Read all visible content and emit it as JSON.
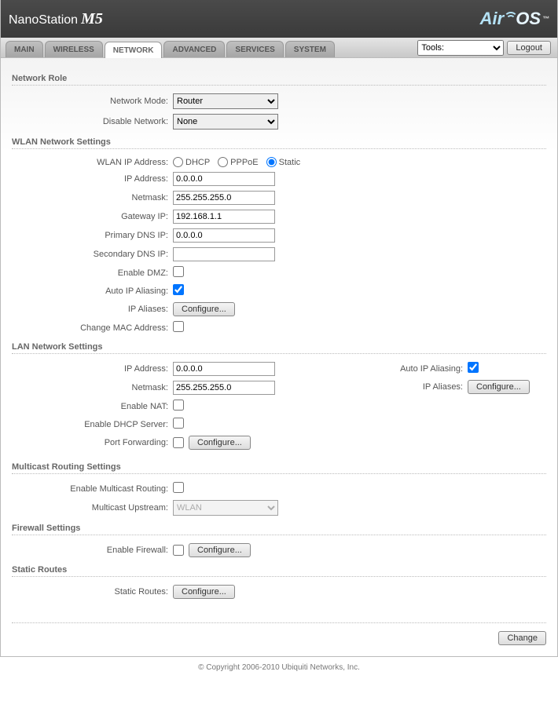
{
  "header": {
    "brand_name": "NanoStation",
    "brand_model": "M5",
    "logo_text_air": "Air",
    "logo_text_os": "OS",
    "logo_tm": "™"
  },
  "tabs": {
    "items": [
      "MAIN",
      "WIRELESS",
      "NETWORK",
      "ADVANCED",
      "SERVICES",
      "SYSTEM"
    ],
    "active_index": 2,
    "tools_label": "Tools:",
    "logout_label": "Logout"
  },
  "sections": {
    "network_role": {
      "title": "Network Role",
      "network_mode_label": "Network Mode:",
      "network_mode_value": "Router",
      "disable_network_label": "Disable Network:",
      "disable_network_value": "None"
    },
    "wlan": {
      "title": "WLAN Network Settings",
      "wlan_ip_label": "WLAN IP Address:",
      "radio_dhcp": "DHCP",
      "radio_pppoe": "PPPoE",
      "radio_static": "Static",
      "ip_address_label": "IP Address:",
      "ip_address_value": "0.0.0.0",
      "netmask_label": "Netmask:",
      "netmask_value": "255.255.255.0",
      "gateway_label": "Gateway IP:",
      "gateway_value": "192.168.1.1",
      "primary_dns_label": "Primary DNS IP:",
      "primary_dns_value": "0.0.0.0",
      "secondary_dns_label": "Secondary DNS IP:",
      "secondary_dns_value": "",
      "enable_dmz_label": "Enable DMZ:",
      "auto_ip_aliasing_label": "Auto IP Aliasing:",
      "ip_aliases_label": "IP Aliases:",
      "configure_label": "Configure...",
      "change_mac_label": "Change MAC Address:"
    },
    "lan": {
      "title": "LAN Network Settings",
      "ip_address_label": "IP Address:",
      "ip_address_value": "0.0.0.0",
      "netmask_label": "Netmask:",
      "netmask_value": "255.255.255.0",
      "enable_nat_label": "Enable NAT:",
      "enable_dhcp_server_label": "Enable DHCP Server:",
      "port_forwarding_label": "Port Forwarding:",
      "configure_label": "Configure...",
      "auto_ip_aliasing_label": "Auto IP Aliasing:",
      "ip_aliases_label": "IP Aliases:",
      "ip_aliases_configure_label": "Configure..."
    },
    "multicast": {
      "title": "Multicast Routing Settings",
      "enable_label": "Enable Multicast Routing:",
      "upstream_label": "Multicast Upstream:",
      "upstream_value": "WLAN"
    },
    "firewall": {
      "title": "Firewall Settings",
      "enable_label": "Enable Firewall:",
      "configure_label": "Configure..."
    },
    "static_routes": {
      "title": "Static Routes",
      "label": "Static Routes:",
      "configure_label": "Configure..."
    }
  },
  "footer": {
    "change_label": "Change",
    "copyright": "© Copyright 2006-2010 Ubiquiti Networks, Inc."
  }
}
